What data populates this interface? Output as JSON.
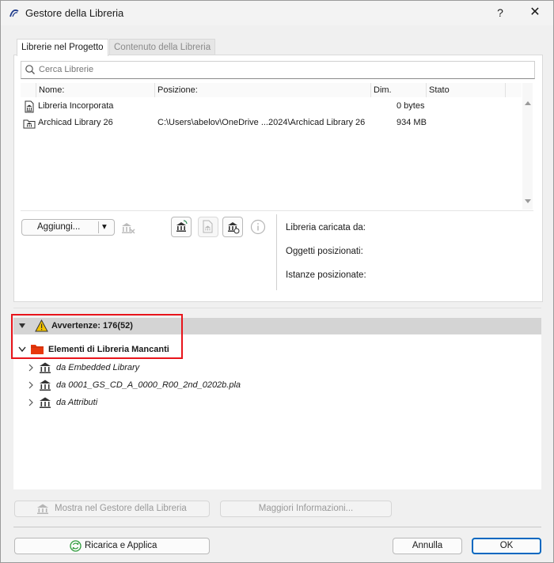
{
  "window": {
    "title": "Gestore della Libreria",
    "help": "?",
    "close": "✕"
  },
  "tabs": [
    {
      "label": "Librerie nel Progetto",
      "active": true
    },
    {
      "label": "Contenuto della Libreria",
      "active": false
    }
  ],
  "search": {
    "placeholder": "Cerca Librerie",
    "value": ""
  },
  "table": {
    "columns": [
      "Nome:",
      "Posizione:",
      "Dim.",
      "Stato"
    ],
    "rows": [
      {
        "name": "Libreria Incorporata",
        "position": "",
        "size": "0 bytes",
        "status": "",
        "icon": "embedded-library-icon"
      },
      {
        "name": "Archicad Library 26",
        "position": "C:\\Users\\abelov\\OneDrive ...2024\\Archicad Library 26",
        "size": "934 MB",
        "status": "",
        "icon": "library-icon"
      }
    ]
  },
  "toolbar": {
    "add_label": "Aggiungi...",
    "dropdown": "▾"
  },
  "info": {
    "loaded_from": "Libreria caricata da:",
    "placed_objects": "Oggetti posizionati:",
    "placed_instances": "Istanze posizionate:"
  },
  "warnings": {
    "header": "Avvertenze: 176(52)",
    "missing_group": "Elementi di Libreria Mancanti",
    "items": [
      "da Embedded Library",
      "da 0001_GS_CD_A_0000_R00_2nd_0202b.pla",
      "da Attributi"
    ]
  },
  "bottom_buttons": {
    "show_in_manager": "Mostra nel Gestore della Libreria",
    "more_info": "Maggiori Informazioni..."
  },
  "footer": {
    "reload": "Ricarica e Applica",
    "cancel": "Annulla",
    "ok": "OK"
  },
  "colors": {
    "highlight_box": "#e8141b",
    "folder": "#e8380d",
    "warning": "#f2c200",
    "ok_border": "#0067c0"
  }
}
